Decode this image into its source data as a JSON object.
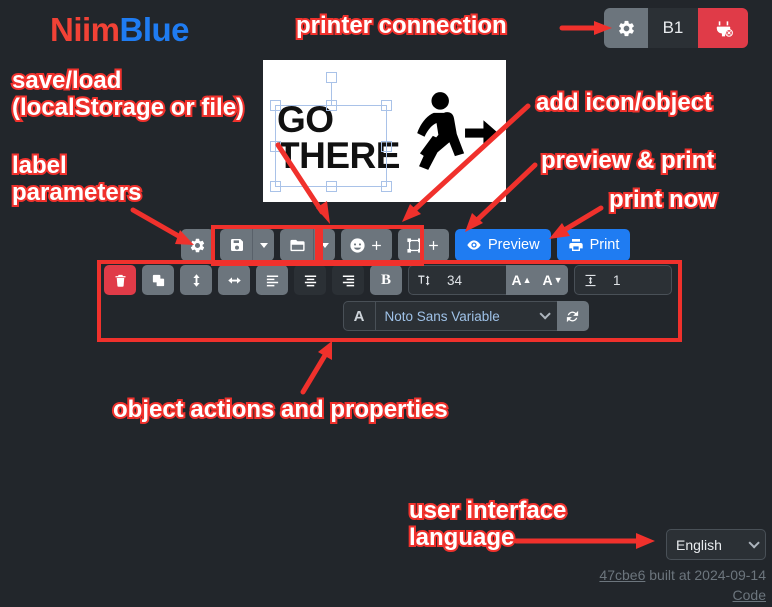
{
  "app": {
    "logo_part1": "Niim",
    "logo_part2": "Blue"
  },
  "printer_connection": {
    "settings_icon": "gear-icon",
    "printer_model": "B1",
    "disconnect_icon": "plug-disconnect-icon",
    "settings_color": "#6c757d",
    "disconnect_color": "#e03b48"
  },
  "canvas": {
    "label_text": "GO\nTHERE",
    "pictogram": "running-man-exit-arrow",
    "background": "#ffffff",
    "selection_color": "#a9c2e8"
  },
  "main_toolbar": {
    "settings_icon": "gear-icon",
    "save_icon": "floppy-disk-icon",
    "save_caret": "chevron-down-icon",
    "open_icon": "folder-open-icon",
    "open_caret": "chevron-down-icon",
    "add_icon_label": "smiley-plus-icon",
    "add_object_label": "frame-plus-icon",
    "preview_label": "Preview",
    "preview_icon": "eye-icon",
    "print_label": "Print",
    "print_icon": "printer-icon",
    "primary_color": "#1f7cf2",
    "button_color": "#6c757d"
  },
  "object_toolbar": {
    "delete_icon": "trash-icon",
    "duplicate_icon": "copy-icon",
    "flip_vertical_icon": "arrows-vertical-icon",
    "flip_horizontal_icon": "arrows-horizontal-icon",
    "align_left_icon": "align-left-icon",
    "align_center_icon": "align-center-icon",
    "align_right_icon": "align-right-icon",
    "bold_label": "B",
    "font_size_icon": "text-height-icon",
    "font_size_value": "34",
    "font_size_increase": "A",
    "font_size_decrease": "A",
    "line_height_icon": "line-height-icon",
    "line_height_value": "1",
    "font_family_icon": "A",
    "font_family_value": "Noto Sans Variable",
    "font_refresh_icon": "refresh-icon",
    "danger_color": "#e03b48"
  },
  "language": {
    "selected": "English",
    "chevron": "chevron-down-icon"
  },
  "footer": {
    "commit": "47cbe6",
    "built_text": " built at 2024-09-14",
    "code_link": "Code"
  },
  "annotations": {
    "printer_connection": "printer connection",
    "save_load": "save/load\n(localStorage or file)",
    "label_parameters": "label\nparameters",
    "add_icon_object": "add icon/object",
    "preview_print": "preview & print",
    "print_now": "print now",
    "object_actions": "object actions and properties",
    "user_language": "user interface\nlanguage",
    "color": "#f0312c"
  }
}
